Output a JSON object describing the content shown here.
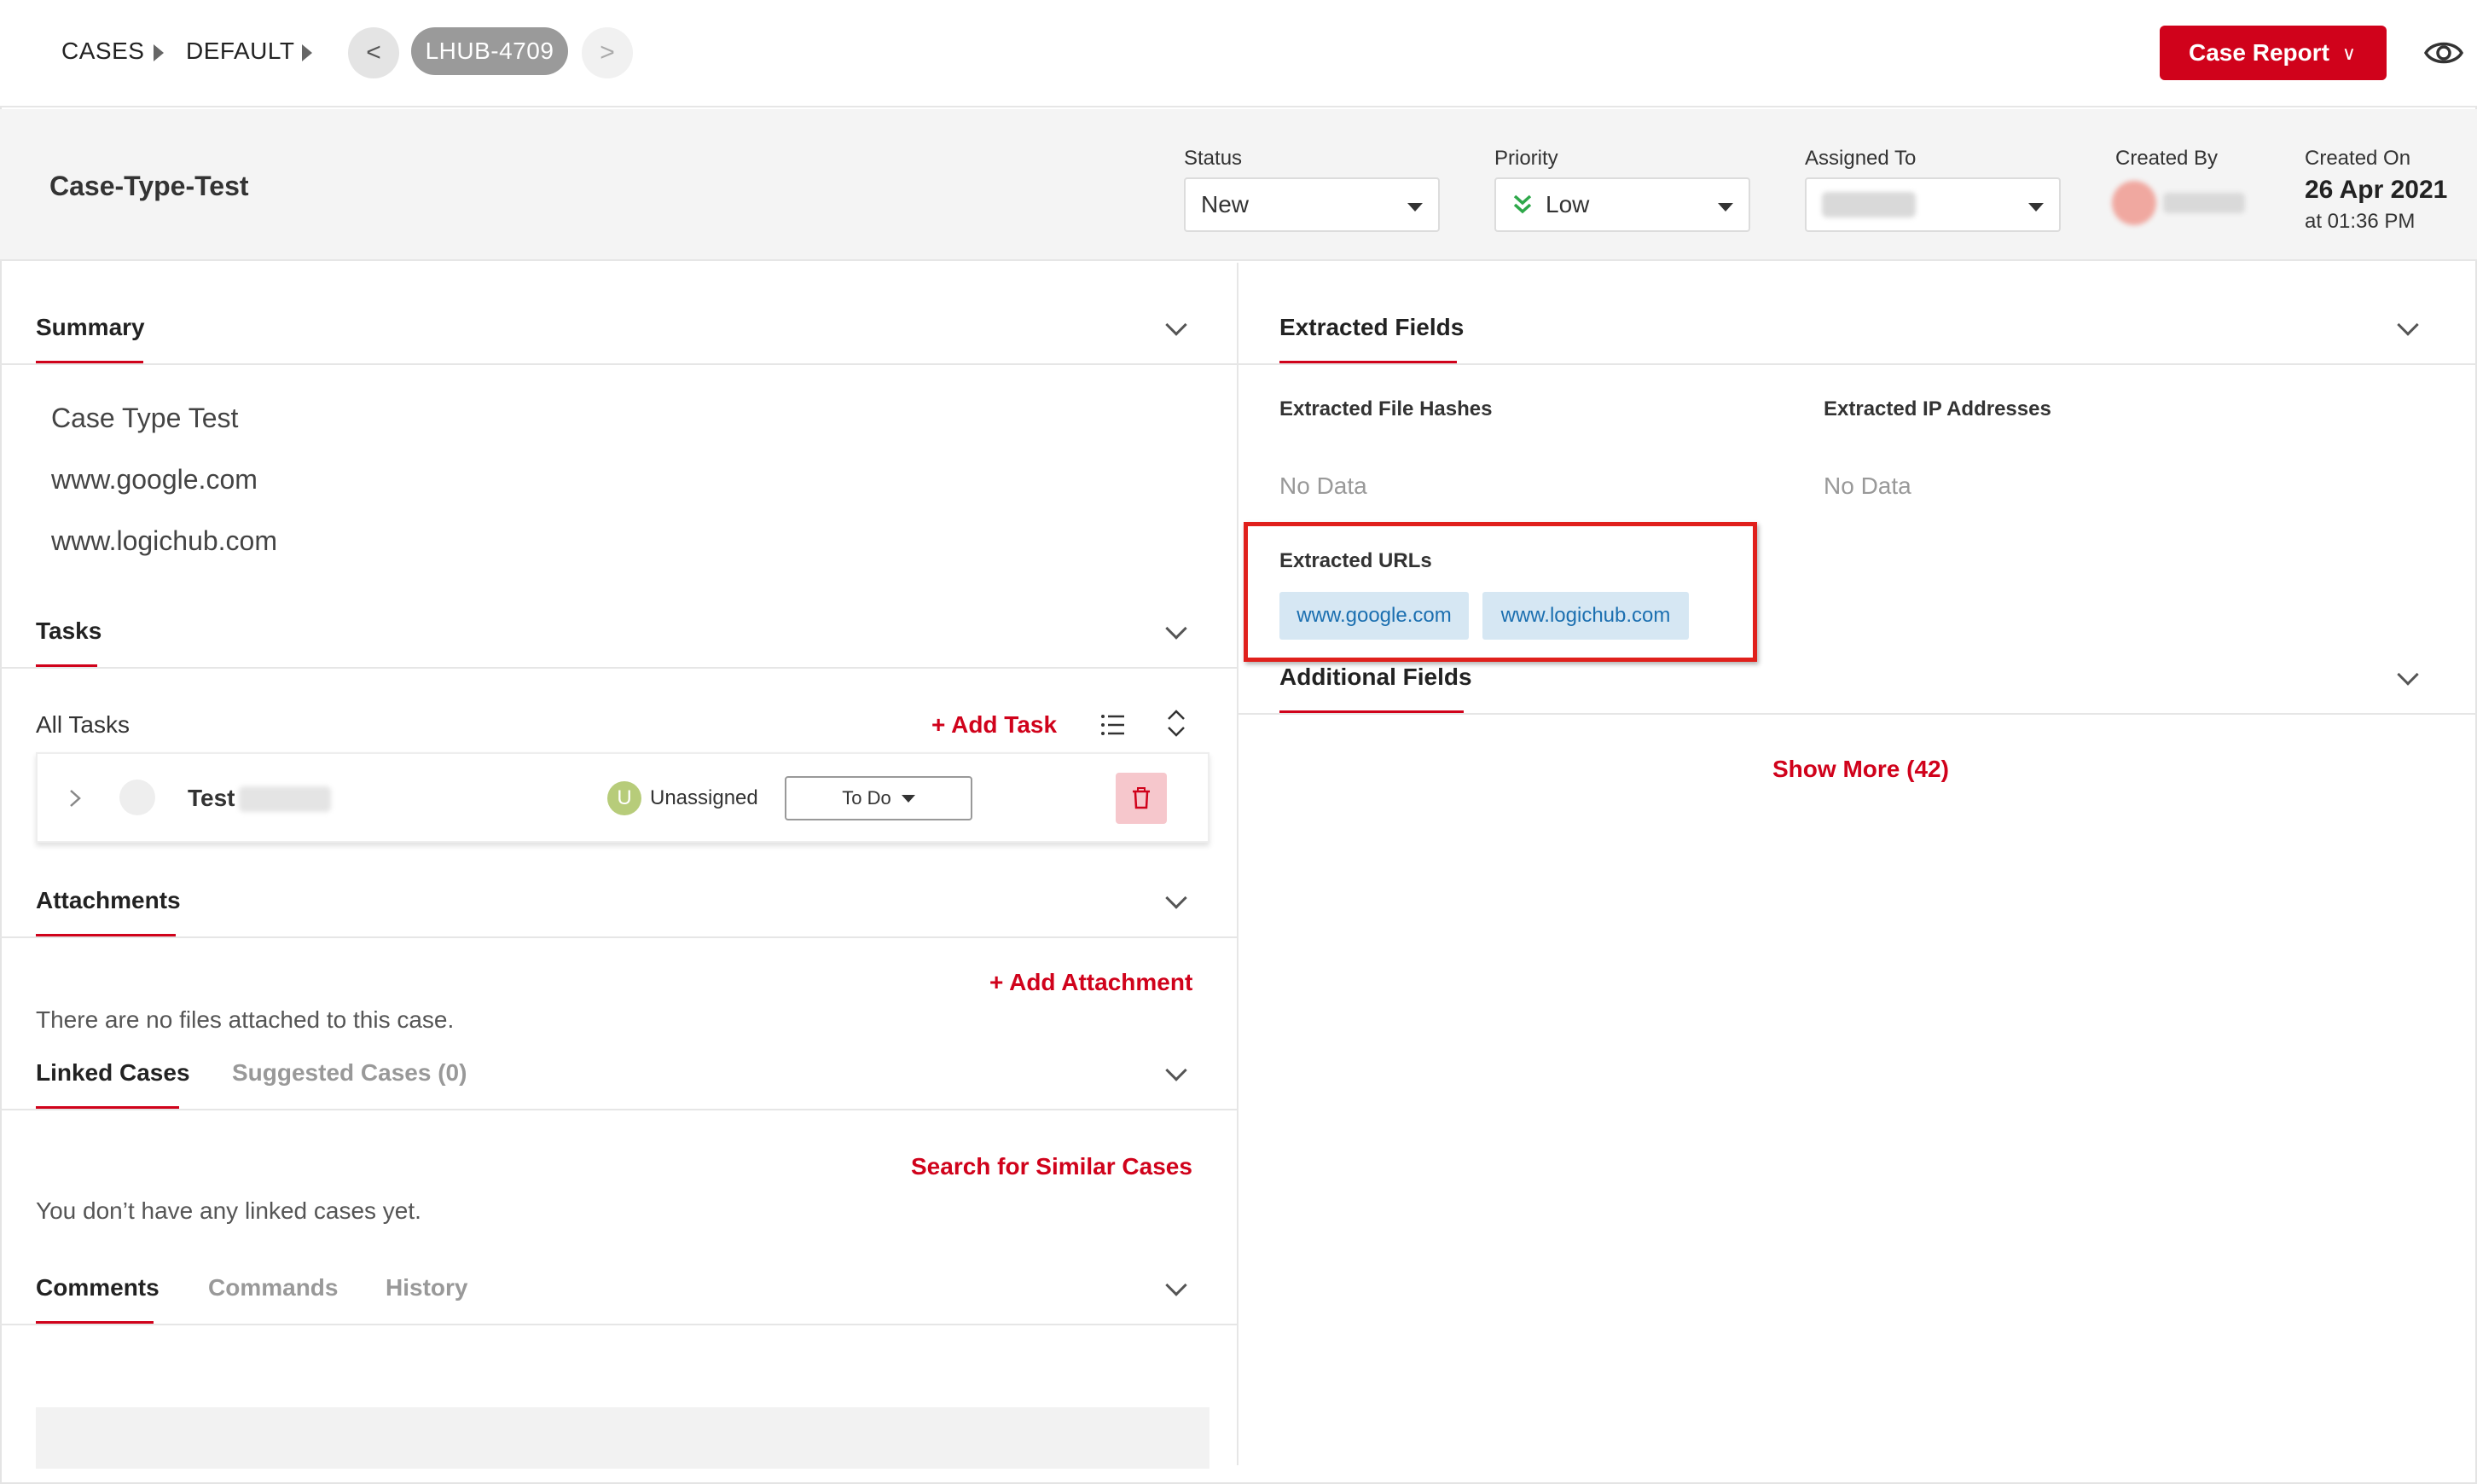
{
  "breadcrumb": {
    "root": "CASES",
    "queue": "DEFAULT"
  },
  "case_nav": {
    "prev_glyph": "<",
    "next_glyph": ">",
    "case_id": "LHUB-4709"
  },
  "toolbar": {
    "report_label": "Case Report",
    "report_chevron": "∨"
  },
  "header": {
    "title": "Case-Type-Test",
    "status": {
      "label": "Status",
      "value": "New"
    },
    "priority": {
      "label": "Priority",
      "value": "Low",
      "icon": "double-chevron-down-icon",
      "icon_color": "#2ea84a"
    },
    "assigned_to": {
      "label": "Assigned To"
    },
    "created_by": {
      "label": "Created By"
    },
    "created_on": {
      "label": "Created On",
      "date": "26 Apr 2021",
      "time": "at 01:36 PM"
    }
  },
  "summary": {
    "heading": "Summary",
    "lines": [
      "Case Type Test",
      "www.google.com",
      "www.logichub.com"
    ]
  },
  "tasks": {
    "heading": "Tasks",
    "all_tasks_label": "All Tasks",
    "add_label": "+ Add Task",
    "items": [
      {
        "title": "Test",
        "assignee_initial": "U",
        "assignee": "Unassigned",
        "status": "To Do"
      }
    ]
  },
  "attachments": {
    "heading": "Attachments",
    "add_label": "+ Add Attachment",
    "empty_text": "There are no files attached to this case."
  },
  "linked": {
    "tab_active": "Linked Cases",
    "tab_inactive": "Suggested Cases (0)",
    "search_label": "Search for Similar Cases",
    "empty_text": "You don’t have any linked cases yet."
  },
  "activity": {
    "tabs": [
      "Comments",
      "Commands",
      "History"
    ]
  },
  "extracted": {
    "heading": "Extracted Fields",
    "file_hashes": {
      "label": "Extracted File Hashes",
      "value": "No Data"
    },
    "ip_addresses": {
      "label": "Extracted IP Addresses",
      "value": "No Data"
    },
    "urls": {
      "label": "Extracted URLs",
      "items": [
        "www.google.com",
        "www.logichub.com"
      ]
    }
  },
  "additional": {
    "heading": "Additional Fields",
    "show_more": "Show More (42)"
  },
  "colors": {
    "accent": "#d0021b",
    "chip_bg": "#d6e7f3",
    "chip_text": "#1b6fb0",
    "highlight": "#e0201c"
  }
}
